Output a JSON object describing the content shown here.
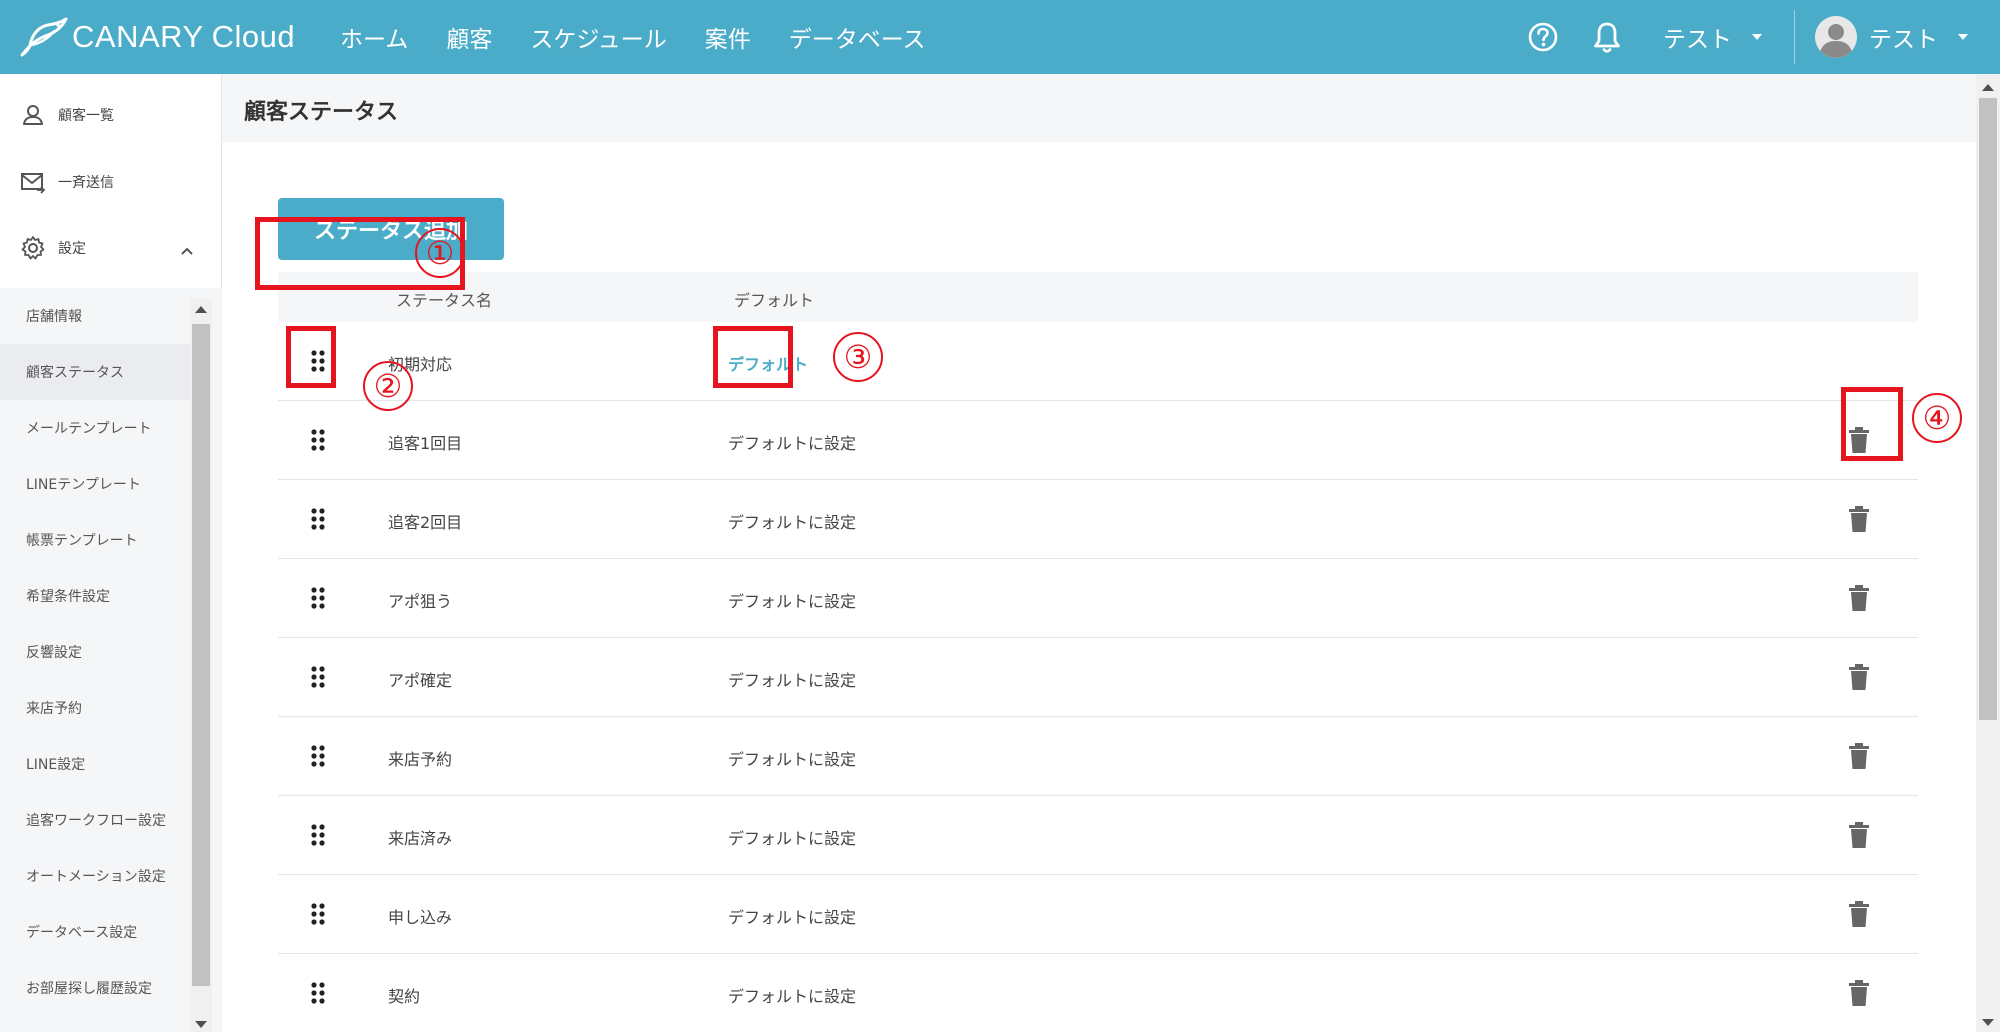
{
  "brand": {
    "name": "CANARY",
    "sub": "Cloud"
  },
  "nav": [
    "ホーム",
    "顧客",
    "スケジュール",
    "案件",
    "データベース"
  ],
  "topbar": {
    "store_label": "テスト",
    "user_label": "テスト"
  },
  "sidebar": {
    "main": [
      {
        "label": "顧客一覧",
        "icon": "user-icon"
      },
      {
        "label": "一斉送信",
        "icon": "mail-send-icon"
      },
      {
        "label": "設定",
        "icon": "gear-icon"
      }
    ],
    "sub": [
      "店舗情報",
      "顧客ステータス",
      "メールテンプレート",
      "LINEテンプレート",
      "帳票テンプレート",
      "希望条件設定",
      "反響設定",
      "来店予約",
      "LINE設定",
      "追客ワークフロー設定",
      "オートメーション設定",
      "データベース設定",
      "お部屋探し履歴設定"
    ],
    "active_sub": 1
  },
  "page": {
    "title": "顧客ステータス",
    "add_button": "ステータス追加",
    "columns": {
      "name": "ステータス名",
      "default": "デフォルト"
    }
  },
  "rows": [
    {
      "name": "初期対応",
      "default": "デフォルト",
      "is_default": true
    },
    {
      "name": "追客1回目",
      "default": "デフォルトに設定",
      "is_default": false
    },
    {
      "name": "追客2回目",
      "default": "デフォルトに設定",
      "is_default": false
    },
    {
      "name": "アポ狙う",
      "default": "デフォルトに設定",
      "is_default": false
    },
    {
      "name": "アポ確定",
      "default": "デフォルトに設定",
      "is_default": false
    },
    {
      "name": "来店予約",
      "default": "デフォルトに設定",
      "is_default": false
    },
    {
      "name": "来店済み",
      "default": "デフォルトに設定",
      "is_default": false
    },
    {
      "name": "申し込み",
      "default": "デフォルトに設定",
      "is_default": false
    },
    {
      "name": "契約",
      "default": "デフォルトに設定",
      "is_default": false
    }
  ],
  "annotations": [
    "①",
    "②",
    "③",
    "④"
  ],
  "colors": {
    "brand": "#4aacc8",
    "annotation": "#e6141e"
  }
}
